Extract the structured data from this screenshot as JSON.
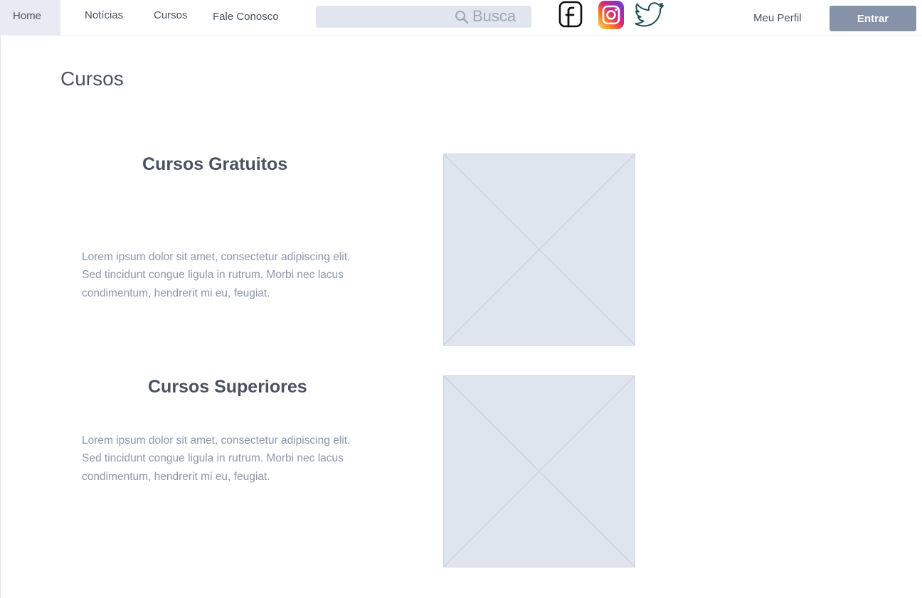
{
  "nav": {
    "home": "Home",
    "noticias": "Notícias",
    "cursos": "Cursos",
    "fale_conosco": "Fale Conosco"
  },
  "search": {
    "label": "Busca",
    "icon": "search-icon"
  },
  "social": {
    "icons": [
      "facebook-icon",
      "instagram-icon",
      "twitter-icon"
    ]
  },
  "account": {
    "meu_perfil": "Meu Perfil",
    "entrar": "Entrar"
  },
  "page": {
    "title": "Cursos"
  },
  "sections": [
    {
      "title": "Cursos Gratuitos",
      "text": "Lorem ipsum dolor sit amet, consectetur adipiscing elit. Sed tincidunt congue ligula in rutrum. Morbi nec lacus condimentum, hendrerit mi eu, feugiat."
    },
    {
      "title": "Cursos Superiores",
      "text": "Lorem ipsum dolor sit amet, consectetur adipiscing elit. Sed tincidunt congue ligula in rutrum. Morbi nec lacus condimentum, hendrerit mi eu, feugiat."
    }
  ],
  "colors": {
    "accent_button": "#8592a7",
    "nav_active": "#e8ecf2",
    "placeholder_fill": "#dfe5ee",
    "placeholder_stroke": "#c8d1de",
    "body_text": "#8a97ab",
    "heading_text": "#4a5260"
  }
}
